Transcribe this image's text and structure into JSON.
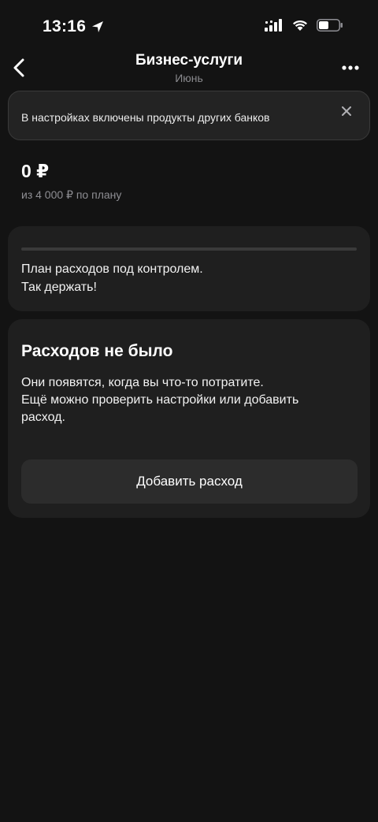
{
  "status_bar": {
    "time": "13:16"
  },
  "nav": {
    "title": "Бизнес-услуги",
    "subtitle": "Июнь"
  },
  "banner": {
    "text": "В настройках включены продукты других банков"
  },
  "summary": {
    "amount": "0 ₽",
    "plan": "из 4 000 ₽ по плану"
  },
  "plan_card": {
    "progress": 0,
    "line1": "План расходов под контролем.",
    "line2": "Так держать!"
  },
  "empty_card": {
    "title": "Расходов не было",
    "line1": "Они появятся, когда вы что-то потратите.",
    "line2": "Ещё можно проверить настройки или добавить",
    "line3": "расход.",
    "button_label": "Добавить расход"
  },
  "colors": {
    "background": "#131313",
    "card": "#1f1f1f",
    "accent": "#6ee087"
  }
}
